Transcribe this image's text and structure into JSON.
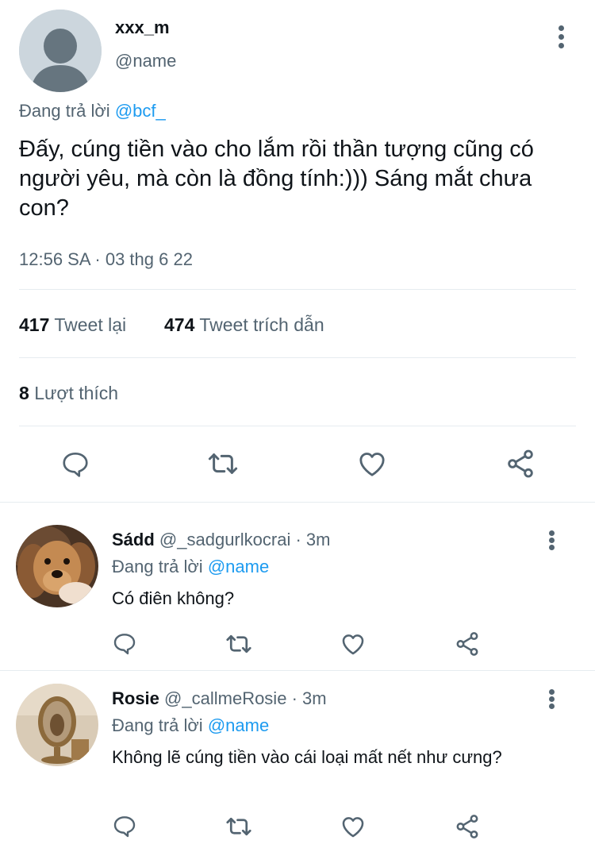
{
  "tweet": {
    "display_name": "xxx_m",
    "handle": "@name",
    "reply_prefix": "Đang trả lời",
    "reply_to": "@bcf_",
    "text": "Đấy, cúng tiền vào cho lắm rồi thần tượng cũng có người yêu, mà còn là đồng tính:))) Sáng mắt chưa con?",
    "timestamp": "12:56 SA · 03 thg 6 22",
    "retweets": "417",
    "retweets_label": "Tweet lại",
    "quotes": "474",
    "quotes_label": "Tweet trích dẫn",
    "likes": "8",
    "likes_label": "Lượt thích"
  },
  "replies": [
    {
      "display_name": "Sádd",
      "handle": "@_sadgurlkocrai",
      "time": "· 3m",
      "reply_prefix": "Đang trả lời",
      "reply_to": "@name",
      "text": "Có điên không?"
    },
    {
      "display_name": "Rosie",
      "handle": "@_callmeRosie",
      "time": "· 3m",
      "reply_prefix": "Đang trả lời",
      "reply_to": "@name",
      "text": "Không lẽ cúng tiền vào cái loại mất nết như cưng?"
    }
  ],
  "colors": {
    "accent": "#1d9bf0",
    "secondary_text": "#536471",
    "divider": "#e6ecf0"
  },
  "icons": [
    "more-icon",
    "reply-icon",
    "retweet-icon",
    "like-icon",
    "share-icon"
  ]
}
